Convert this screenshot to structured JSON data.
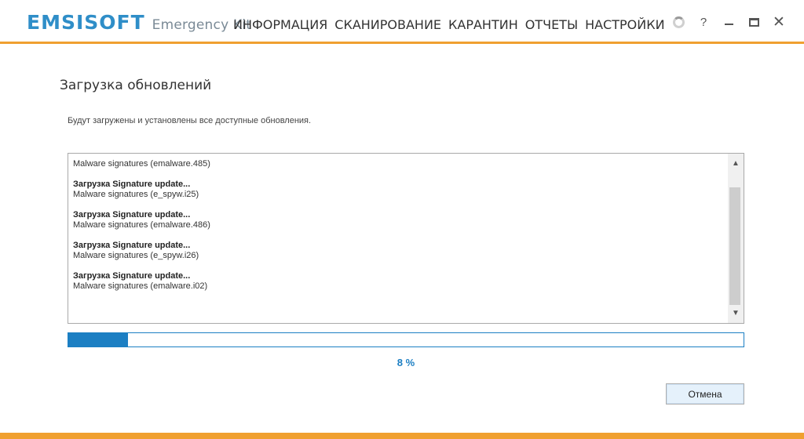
{
  "app": {
    "brand": "EMSISOFT",
    "product": "Emergency Kit"
  },
  "nav": {
    "items": [
      {
        "label": "ИНФОРМАЦИЯ"
      },
      {
        "label": "СКАНИРОВАНИЕ"
      },
      {
        "label": "КАРАНТИН"
      },
      {
        "label": "ОТЧЕТЫ"
      },
      {
        "label": "НАСТРОЙКИ"
      }
    ]
  },
  "window_controls": {
    "help": "?",
    "close": "✕"
  },
  "page": {
    "title": "Загрузка обновлений",
    "description": "Будут загружены и установлены все доступные обновления."
  },
  "log": {
    "first_line": "Malware signatures (emalware.485)",
    "entries": [
      {
        "title": "Загрузка Signature update...",
        "detail": "Malware signatures (e_spyw.i25)"
      },
      {
        "title": "Загрузка Signature update...",
        "detail": "Malware signatures (emalware.486)"
      },
      {
        "title": "Загрузка Signature update...",
        "detail": "Malware signatures (e_spyw.i26)"
      },
      {
        "title": "Загрузка Signature update...",
        "detail": "Malware signatures (emalware.i02)"
      }
    ]
  },
  "progress": {
    "value": 0.088,
    "label": "8 %"
  },
  "buttons": {
    "cancel": "Отмена"
  },
  "colors": {
    "accent": "#f0a030",
    "brand_blue": "#2f8ec8",
    "progress_blue": "#1c7fc3"
  }
}
